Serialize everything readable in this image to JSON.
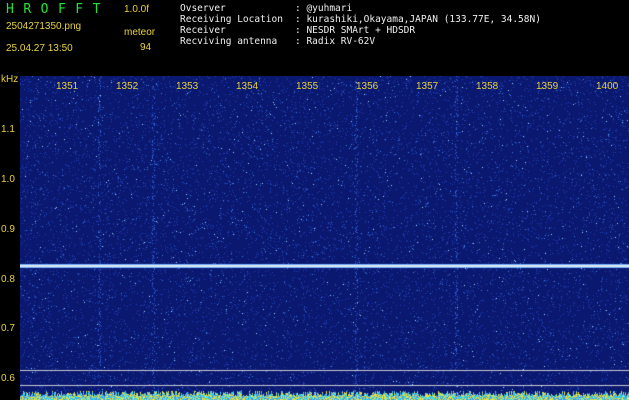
{
  "header": {
    "app_title": "HROFFT",
    "version": "1.0.0f",
    "filename": "2504271350.png",
    "mode": "meteor",
    "datetime": "25.04.27 13:50",
    "count": "94"
  },
  "info": [
    {
      "label": "Ovserver",
      "value": ": @yuhmari"
    },
    {
      "label": "Receiving Location",
      "value": ": kurashiki,Okayama,JAPAN (133.77E, 34.58N)"
    },
    {
      "label": "Receiver",
      "value": ": NESDR SMArt + HDSDR"
    },
    {
      "label": "Recviving antenna",
      "value": ": Radix RV-62V"
    }
  ],
  "axes": {
    "y_unit": "kHz",
    "x_ticks": [
      "1351",
      "1352",
      "1353",
      "1354",
      "1355",
      "1356",
      "1357",
      "1358",
      "1359",
      "1400"
    ],
    "y_ticks": [
      "1.1",
      "1.0",
      "0.9",
      "0.8",
      "0.7",
      "0.6"
    ]
  },
  "colors": {
    "background": "#0a1870",
    "signal_line": "#dfe8f0",
    "label": "#e8d23a",
    "title": "#21e23a"
  }
}
